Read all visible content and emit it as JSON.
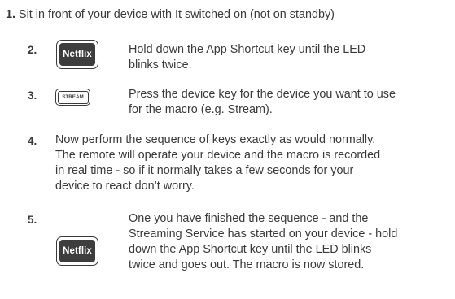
{
  "step1": {
    "number": "1.",
    "text": "Sit in front of your device with It switched on (not on standby)"
  },
  "step2": {
    "number": "2.",
    "key_label": "Netflix",
    "key_icon": "netflix-key-icon",
    "lines": [
      "Hold down the App Shortcut key until the LED",
      "blinks twice."
    ]
  },
  "step3": {
    "number": "3.",
    "key_label": "STREAM",
    "key_icon": "stream-key-icon",
    "lines": [
      "Press the device key for the device you want to use",
      "for the macro (e.g. Stream)."
    ]
  },
  "step4": {
    "number": "4.",
    "lines": [
      "Now perform the sequence of keys exactly as would normally.",
      "The remote will operate your device and the macro is recorded",
      "in real time - so if it normally takes a few seconds for your",
      "device to react don’t worry."
    ]
  },
  "step5": {
    "number": "5.",
    "key_label": "Netflix",
    "key_icon": "netflix-key-icon",
    "lines": [
      "One you have finished the sequence - and the",
      "Streaming Service has started on your device - hold",
      "down the App Shortcut key until the LED blinks",
      "twice and goes out. The macro is now stored."
    ]
  }
}
